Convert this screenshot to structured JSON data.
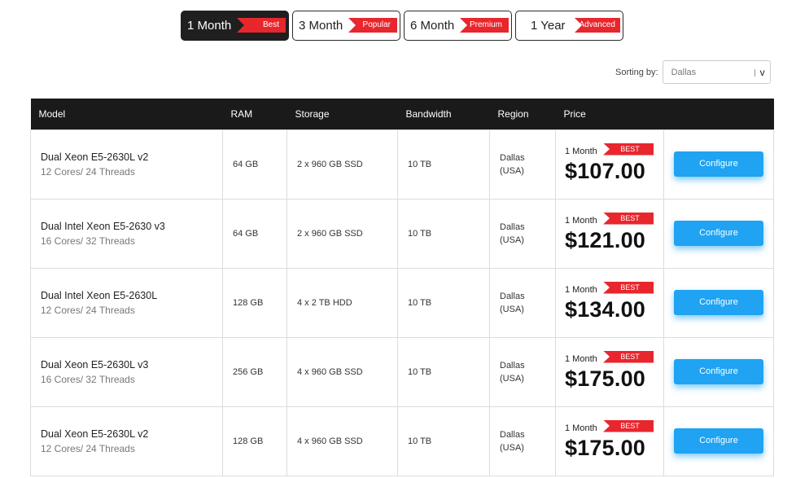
{
  "tabs": [
    {
      "label": "1 Month",
      "badge": "Best",
      "active": true
    },
    {
      "label": "3 Month",
      "badge": "Popular",
      "active": false
    },
    {
      "label": "6 Month",
      "badge": "Premium",
      "active": false
    },
    {
      "label": "1 Year",
      "badge": "Advanced",
      "active": false
    }
  ],
  "sorting": {
    "label": "Sorting by:",
    "selected": "Dallas",
    "arrow": "v"
  },
  "table": {
    "headers": [
      "Model",
      "RAM",
      "Storage",
      "Bandwidth",
      "Region",
      "Price",
      ""
    ],
    "rows": [
      {
        "model": "Dual Xeon E5-2630L v2",
        "cores": "12 Cores/ 24 Threads",
        "ram": "64 GB",
        "storage": "2 x 960 GB SSD",
        "bandwidth": "10 TB",
        "region_city": "Dallas",
        "region_country": "(USA)",
        "period": "1 Month",
        "badge": "BEST",
        "price": "$107.00",
        "button": "Configure"
      },
      {
        "model": "Dual Intel Xeon E5-2630 v3",
        "cores": "16 Cores/ 32 Threads",
        "ram": "64 GB",
        "storage": "2 x 960 GB SSD",
        "bandwidth": "10 TB",
        "region_city": "Dallas",
        "region_country": "(USA)",
        "period": "1 Month",
        "badge": "BEST",
        "price": "$121.00",
        "button": "Configure"
      },
      {
        "model": "Dual Intel Xeon E5-2630L",
        "cores": "12 Cores/ 24 Threads",
        "ram": "128 GB",
        "storage": "4 x 2 TB HDD",
        "bandwidth": "10 TB",
        "region_city": "Dallas",
        "region_country": "(USA)",
        "period": "1 Month",
        "badge": "BEST",
        "price": "$134.00",
        "button": "Configure"
      },
      {
        "model": "Dual Xeon E5-2630L v3",
        "cores": "16 Cores/ 32 Threads",
        "ram": "256 GB",
        "storage": "4 x 960 GB SSD",
        "bandwidth": "10 TB",
        "region_city": "Dallas",
        "region_country": "(USA)",
        "period": "1 Month",
        "badge": "BEST",
        "price": "$175.00",
        "button": "Configure"
      },
      {
        "model": "Dual Xeon E5-2630L v2",
        "cores": "12 Cores/ 24 Threads",
        "ram": "128 GB",
        "storage": "4 x 960 GB SSD",
        "bandwidth": "10 TB",
        "region_city": "Dallas",
        "region_country": "(USA)",
        "period": "1 Month",
        "badge": "BEST",
        "price": "$175.00",
        "button": "Configure"
      }
    ]
  },
  "colors": {
    "accent": "#1fa3f2",
    "badge": "#e8262d",
    "header": "#1a1a1a"
  }
}
